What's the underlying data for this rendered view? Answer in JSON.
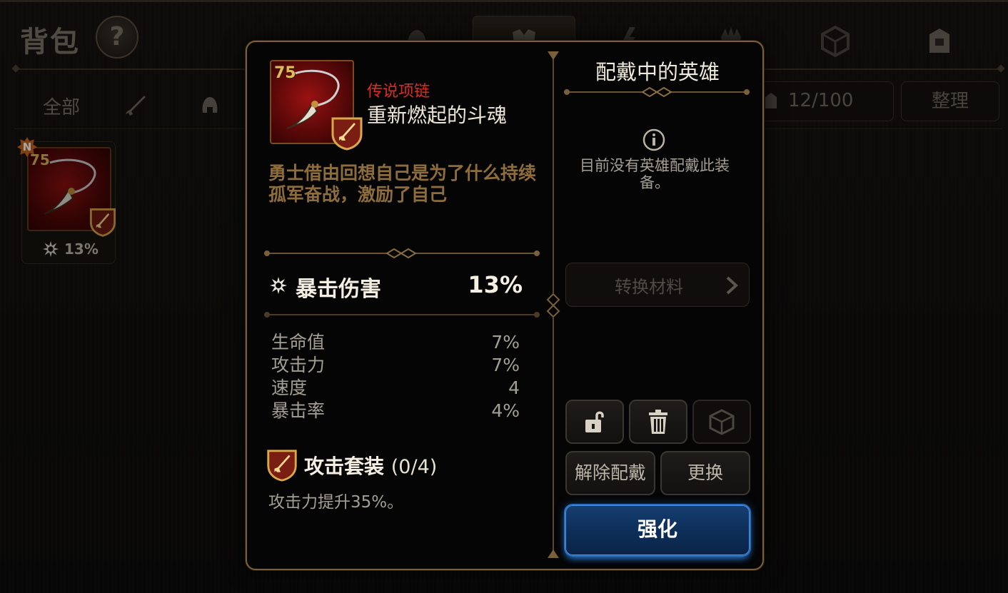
{
  "inventory": {
    "title": "背包",
    "help_label": "?",
    "filter_all": "全部",
    "capacity": "12/100",
    "sort_label": "整理",
    "category_tabs": [
      "helmet-icon",
      "armor-icon",
      "weapon-icon",
      "gloves-icon",
      "rune-icon",
      "bag-icon"
    ],
    "item": {
      "new_badge": "N",
      "level": "75",
      "stat": "13%"
    }
  },
  "item_detail": {
    "level": "75",
    "rarity": "传说项链",
    "name": "重新燃起的斗魂",
    "description": "勇士借由回想自己是为了什么持续孤军奋战，激励了自己",
    "main_stat": {
      "name": "暴击伤害",
      "value": "13%"
    },
    "sub_stats": [
      {
        "name": "生命值",
        "value": "7%"
      },
      {
        "name": "攻击力",
        "value": "7%"
      },
      {
        "name": "速度",
        "value": "4"
      },
      {
        "name": "暴击率",
        "value": "4%"
      }
    ],
    "set": {
      "name": "攻击套装",
      "progress": "(0/4)",
      "bonus": "攻击力提升35%。"
    }
  },
  "equip_panel": {
    "title": "配戴中的英雄",
    "no_hero_text": "目前没有英雄配戴此装备。",
    "convert_label": "转换材料",
    "unequip_label": "解除配戴",
    "replace_label": "更换",
    "enhance_label": "强化"
  },
  "colors": {
    "rarity_red": "#e0291f",
    "enhance_blue": "#163f72",
    "frame_gold": "#7a5f3a",
    "desc_brown": "#8e6d3c"
  }
}
